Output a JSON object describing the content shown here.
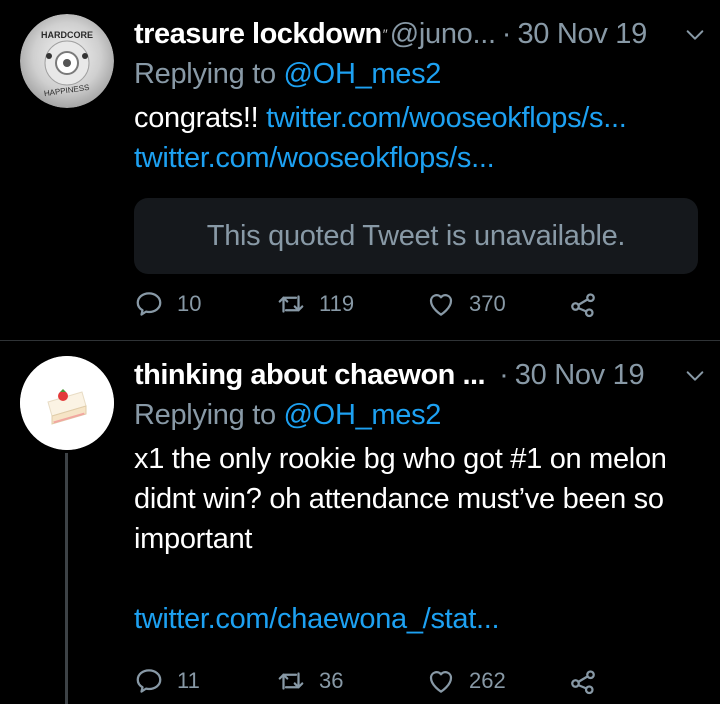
{
  "tweets": [
    {
      "display_name": "treasure lockdown",
      "handle": "@juno...",
      "separator": "·",
      "date": "30 Nov 19",
      "replying_prefix": "Replying to ",
      "replying_to": "@OH_mes2",
      "text_prefix": "congrats!! ",
      "links": [
        "twitter.com/wooseokflops/s...",
        "twitter.com/wooseokflops/s..."
      ],
      "quoted_tweet": "This quoted Tweet is unavailable.",
      "avatar_text_top": "HARDCORE",
      "avatar_text_bottom": "HAPPINESS",
      "replies": "10",
      "retweets": "119",
      "likes": "370"
    },
    {
      "display_name": "thinking about chaewon ...",
      "separator": "·",
      "date": "30 Nov 19",
      "replying_prefix": "Replying to ",
      "replying_to": "@OH_mes2",
      "text": "x1 the only rookie bg who got #1 on melon didnt win? oh attendance must’ve been so important",
      "link": "twitter.com/chaewona_/stat...",
      "replies": "11",
      "retweets": "36",
      "likes": "262"
    }
  ],
  "colors": {
    "background": "#000000",
    "secondary_text": "#8899a6",
    "link": "#1da1f2",
    "divider": "#2f3336",
    "quoted_bg": "#15181c"
  },
  "icons": [
    "reply-icon",
    "retweet-icon",
    "like-icon",
    "share-icon",
    "chevron-down-icon"
  ]
}
